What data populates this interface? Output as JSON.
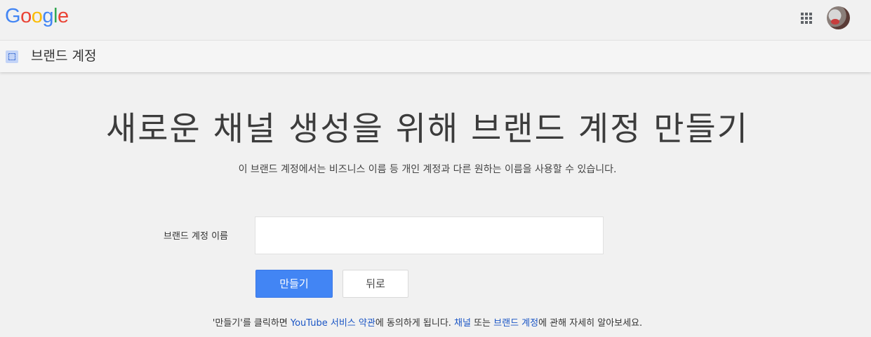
{
  "header": {
    "logo_letters": [
      "G",
      "o",
      "o",
      "g",
      "l",
      "e"
    ],
    "logo_colors": [
      "#4285F4",
      "#EA4335",
      "#FBBC05",
      "#4285F4",
      "#34A853",
      "#EA4335"
    ],
    "apps_icon": "apps-grid-icon",
    "avatar_icon": "account-avatar"
  },
  "subbar": {
    "icon": "brand-account-icon",
    "title": "브랜드 계정"
  },
  "main": {
    "headline": "새로운 채널 생성을 위해 브랜드 계정 만들기",
    "subheadline": "이 브랜드 계정에서는 비즈니스 이름 등 개인 계정과 다른 원하는 이름을 사용할 수 있습니다.",
    "form": {
      "name_label": "브랜드 계정 이름",
      "name_value": "",
      "name_placeholder": ""
    },
    "buttons": {
      "create": "만들기",
      "back": "뒤로"
    },
    "footer": {
      "part1": "'만들기'를 클릭하면 ",
      "terms_link": "YouTube 서비스 약관",
      "part2": "에 동의하게 됩니다. ",
      "channel_link": "채널",
      "part3": " 또는 ",
      "brand_link": "브랜드 계정",
      "part4": "에 관해 자세히 알아보세요."
    }
  },
  "colors": {
    "primary_button": "#4285f4",
    "link": "#1a55c5",
    "background": "#f1f1f1"
  }
}
